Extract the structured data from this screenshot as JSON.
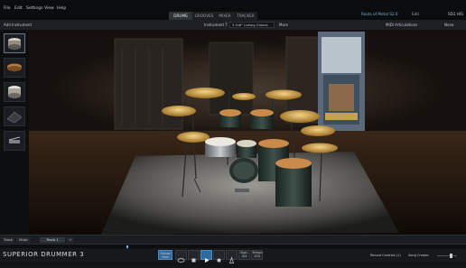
{
  "menu": [
    "File",
    "Edit",
    "Settings",
    "View",
    "Help"
  ],
  "main_tabs": [
    {
      "label": "DRUMS",
      "active": true
    },
    {
      "label": "GROOVES",
      "active": false
    },
    {
      "label": "MIXER",
      "active": false
    },
    {
      "label": "TRACKER",
      "active": false
    }
  ],
  "preset_name": "Roots of Metal S2.0",
  "preset_tag": "Edit",
  "preset_right": "SD1 HIS",
  "toolbar": {
    "add_instrument": "Add Instrument",
    "instrument_label": "Instrument 7",
    "instrument_value": "5.5x6\" Ludwig Groove Fury",
    "more": "More",
    "midi_articulations": "MIDI Articulations",
    "none": "None"
  },
  "sidebar_icons": [
    "snare-thumb-icon",
    "tom-thumb-icon",
    "kick-thumb-icon",
    "stand-thumb-icon",
    "pedal-thumb-icon"
  ],
  "trackbar": {
    "tracks": "Track",
    "mute": "Mute",
    "track_name": "Track 1",
    "add": "+"
  },
  "transport": {
    "logo": "SUPERIOR DRUMMER 3",
    "follow_host": "Follow Host",
    "sign": "Sign. 4/4",
    "tempo": "Tempo 120",
    "record_controls": "Record Controls (1)",
    "song_creator": "Song Creator"
  }
}
